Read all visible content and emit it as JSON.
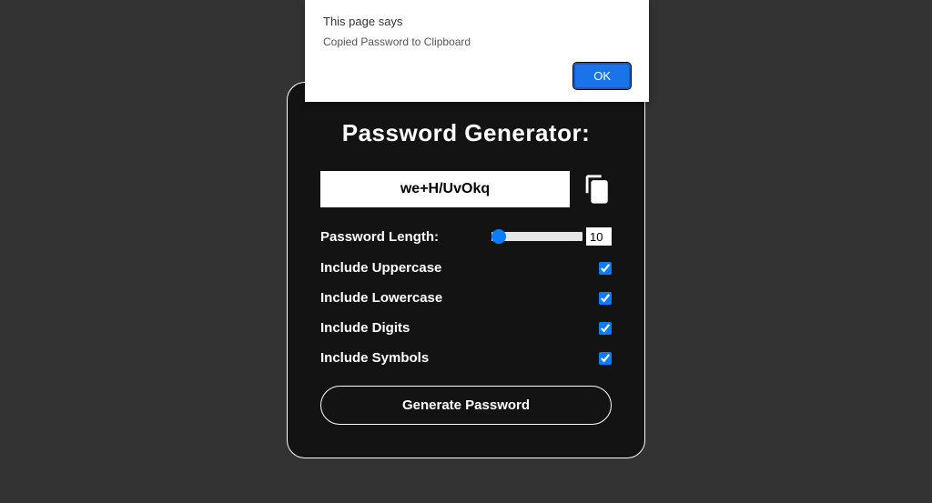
{
  "alert": {
    "title": "This page says",
    "message": "Copied Password to Clipboard",
    "ok_label": "OK"
  },
  "card": {
    "title": "Password Generator:",
    "password_value": "we+H/UvOkq",
    "length_label": "Password Length:",
    "length_value": "10",
    "options": [
      {
        "label": "Include Uppercase",
        "checked": true
      },
      {
        "label": "Include Lowercase",
        "checked": true
      },
      {
        "label": "Include Digits",
        "checked": true
      },
      {
        "label": "Include Symbols",
        "checked": true
      }
    ],
    "generate_label": "Generate Password"
  },
  "icons": {
    "copy": "copy-icon"
  },
  "colors": {
    "accent": "#0a7cff",
    "card_bg": "#131313",
    "page_bg": "#333333"
  }
}
